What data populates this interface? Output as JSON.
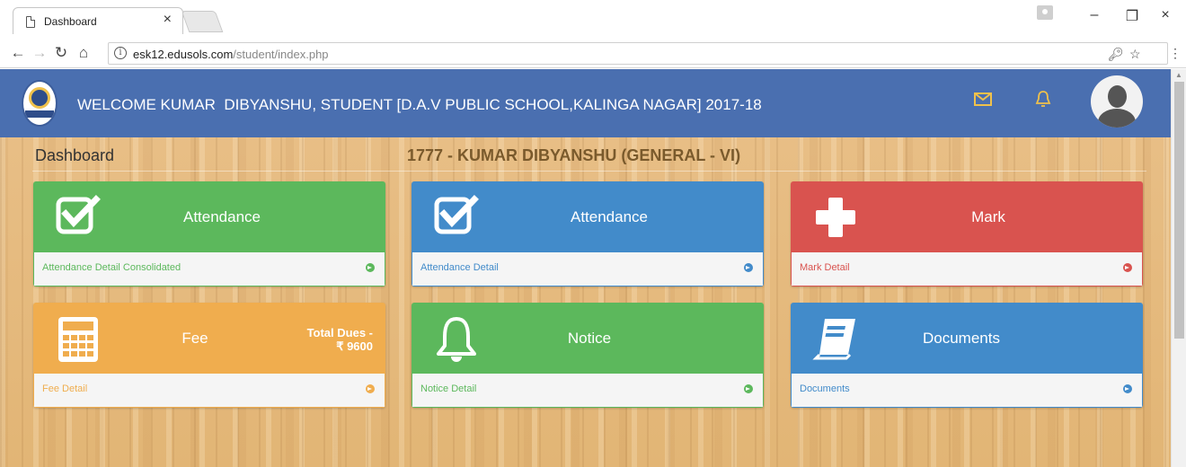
{
  "browser": {
    "tab_title": "Dashboard",
    "tab_close": "×",
    "url_host": "esk12.edusols.com",
    "url_path": "/student/index.php",
    "minimize": "–",
    "restore": "❐",
    "close": "×"
  },
  "header": {
    "welcome": "WELCOME KUMAR  DIBYANSHU, STUDENT [D.A.V PUBLIC SCHOOL,KALINGA NAGAR] 2017-18",
    "accent_color": "#f0c14b",
    "bar_color": "#4a6fb0"
  },
  "page": {
    "breadcrumb": "Dashboard",
    "student_line": "1777 - KUMAR DIBYANSHU (GENERAL - VI)"
  },
  "cards": [
    {
      "title": "Attendance",
      "link": "Attendance Detail Consolidated",
      "color": "#5cb85c",
      "icon": "checkbox-icon"
    },
    {
      "title": "Attendance",
      "link": "Attendance Detail",
      "color": "#428bca",
      "icon": "checkbox-icon"
    },
    {
      "title": "Mark",
      "link": "Mark Detail",
      "color": "#d9534f",
      "icon": "plus-icon"
    },
    {
      "title": "Fee",
      "link": "Fee Detail",
      "color": "#f0ad4e",
      "icon": "calculator-icon",
      "dues_label": "Total Dues -",
      "dues_amount": "₹ 9600"
    },
    {
      "title": "Notice",
      "link": "Notice Detail",
      "color": "#5cb85c",
      "icon": "bell-icon"
    },
    {
      "title": "Documents",
      "link": "Documents",
      "color": "#428bca",
      "icon": "book-icon"
    }
  ]
}
